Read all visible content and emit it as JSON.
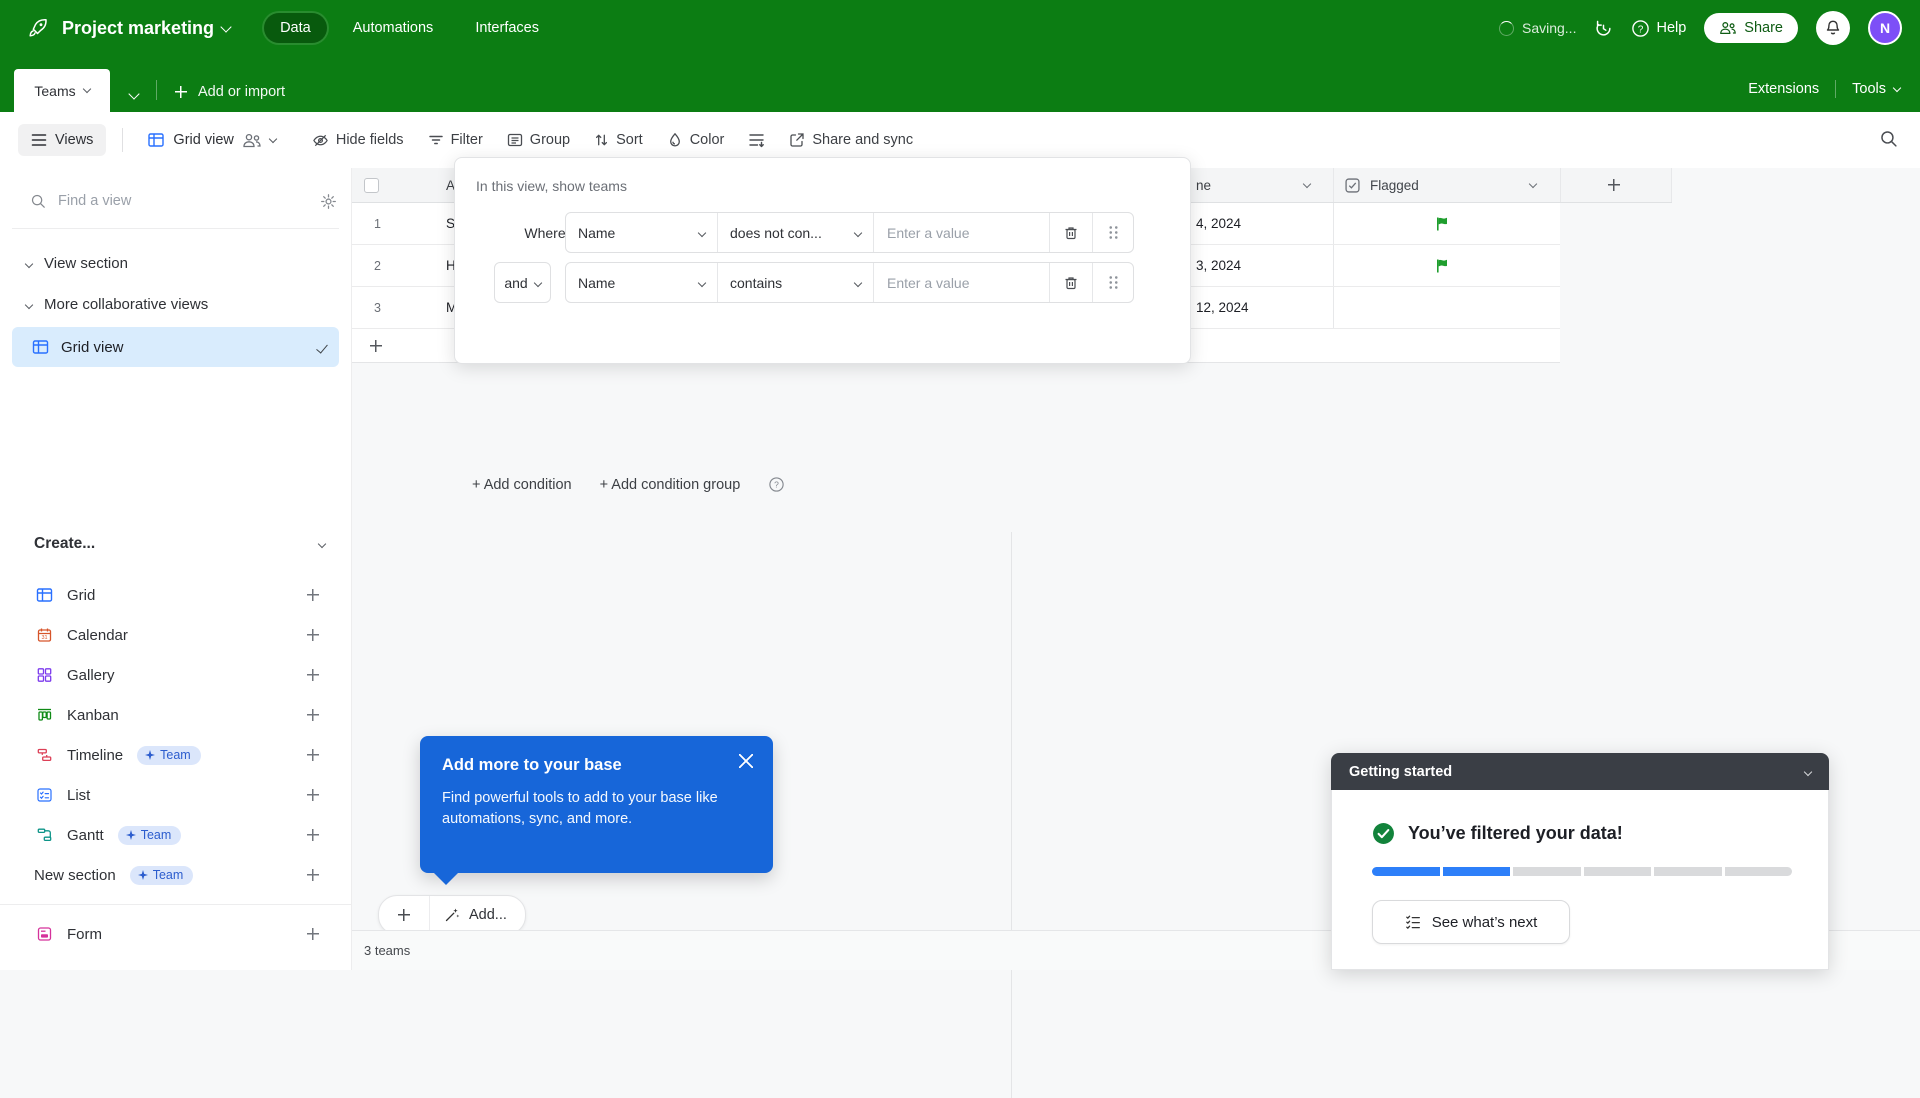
{
  "header": {
    "app_title": "Project marketing",
    "nav": [
      {
        "label": "Data",
        "active": true
      },
      {
        "label": "Automations",
        "active": false
      },
      {
        "label": "Interfaces",
        "active": false
      }
    ],
    "saving_status": "Saving...",
    "help_label": "Help",
    "share_label": "Share",
    "avatar_initial": "N"
  },
  "tab_bar": {
    "active_tab": "Teams",
    "add_label": "Add or import",
    "extensions_label": "Extensions",
    "tools_label": "Tools"
  },
  "toolbar": {
    "views_label": "Views",
    "view_name": "Grid view",
    "hide_fields_label": "Hide fields",
    "filter_label": "Filter",
    "group_label": "Group",
    "sort_label": "Sort",
    "color_label": "Color",
    "share_sync_label": "Share and sync"
  },
  "sidebar": {
    "search_placeholder": "Find a view",
    "section_1": "View section",
    "section_2": "More collaborative views",
    "selected_view": "Grid view",
    "create_label": "Create...",
    "create_items": [
      {
        "label": "Grid",
        "badge": ""
      },
      {
        "label": "Calendar",
        "badge": ""
      },
      {
        "label": "Gallery",
        "badge": ""
      },
      {
        "label": "Kanban",
        "badge": ""
      },
      {
        "label": "Timeline",
        "badge": "Team"
      },
      {
        "label": "List",
        "badge": ""
      },
      {
        "label": "Gantt",
        "badge": "Team"
      },
      {
        "label": "New section",
        "badge": "Team"
      },
      {
        "label": "Form",
        "badge": ""
      }
    ]
  },
  "filter_panel": {
    "title": "In this view, show teams",
    "rows": [
      {
        "conjunction": "Where",
        "field": "Name",
        "operator": "does not con...",
        "value_placeholder": "Enter a value"
      },
      {
        "conjunction": "and",
        "field": "Name",
        "operator": "contains",
        "value_placeholder": "Enter a value"
      }
    ],
    "add_condition": "+ Add condition",
    "add_condition_group": "+ Add condition group"
  },
  "table": {
    "header": {
      "name_fragment": "A",
      "date_fragment": "ne",
      "flagged_label": "Flagged"
    },
    "rows": [
      {
        "num": "1",
        "name_fragment": "S",
        "date_fragment": "4, 2024",
        "flagged": true
      },
      {
        "num": "2",
        "name_fragment": "H",
        "date_fragment": "3, 2024",
        "flagged": true
      },
      {
        "num": "3",
        "name_fragment": "M",
        "date_fragment": "12, 2024",
        "flagged": false
      }
    ],
    "add_record_label": "Add...",
    "record_count": "3 teams"
  },
  "tooltip": {
    "title": "Add more to your base",
    "body": "Find powerful tools to add to your base like automations, sync, and more."
  },
  "getting_started": {
    "title": "Getting started",
    "message": "You’ve filtered your data!",
    "progress_done": 2,
    "progress_total": 6,
    "cta": "See what’s next"
  },
  "colors": {
    "base_green": "#0c7d13",
    "tooltip_blue": "#1766d9",
    "progress_blue": "#2d7ff9",
    "flag_green": "#1f9e2e",
    "avatar_purple": "#7d4ff7",
    "selected_view_bg": "#d9ecfd",
    "badge_blue": "#2c5dce"
  }
}
